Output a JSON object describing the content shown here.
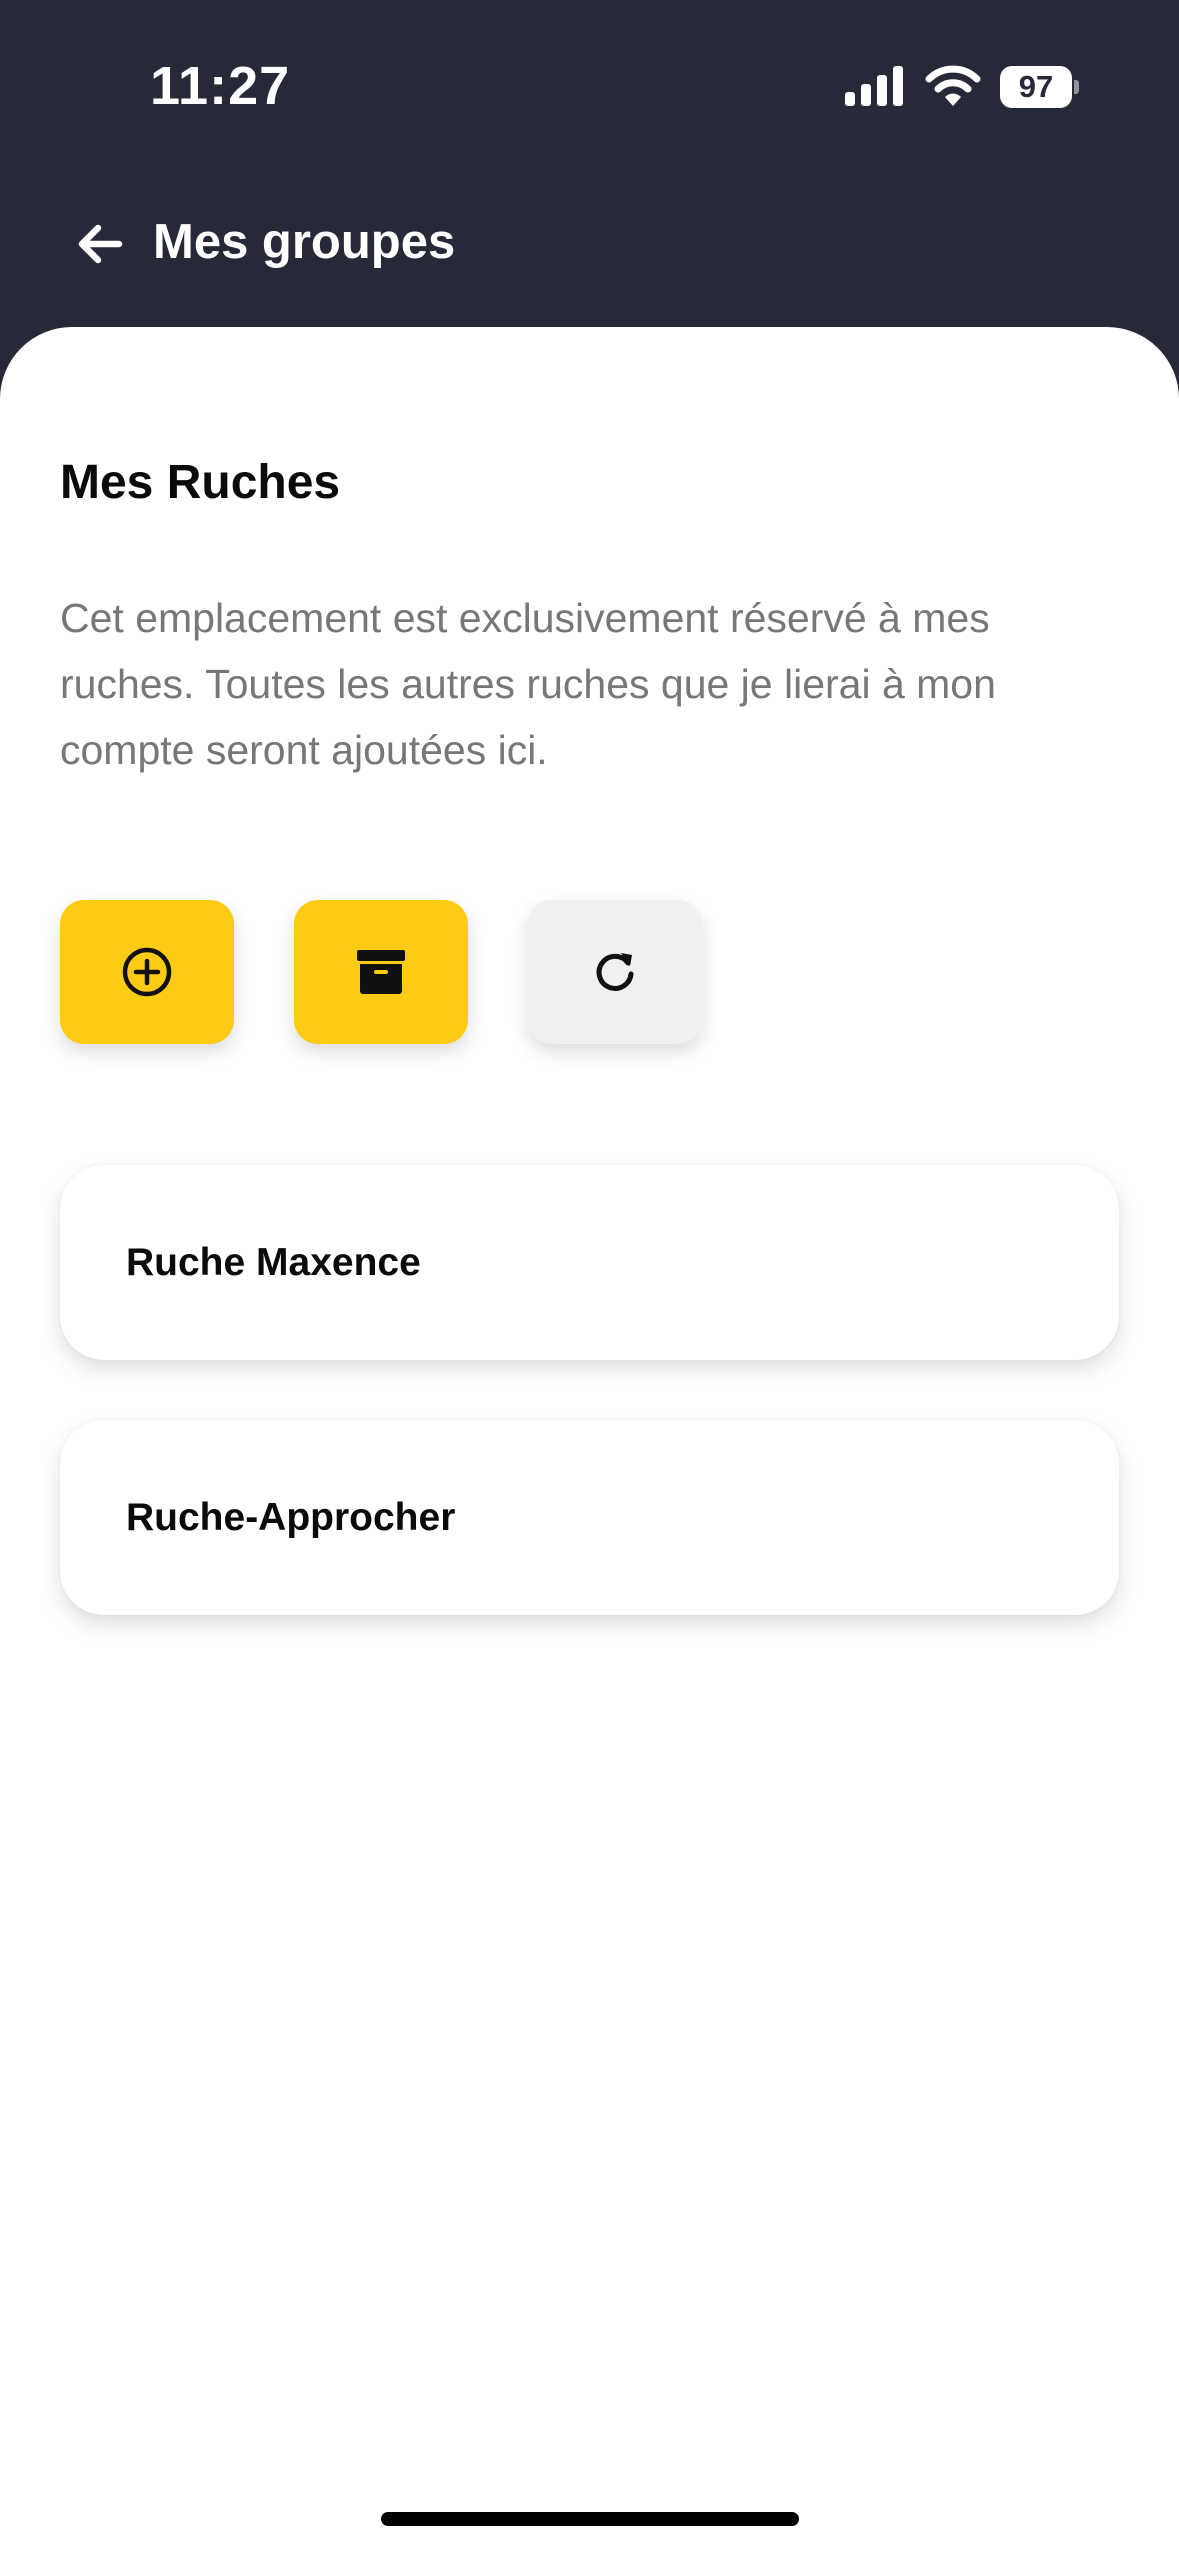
{
  "status_bar": {
    "time": "11:27",
    "battery_level": "97",
    "signal_icon": "cellular-signal-icon",
    "wifi_icon": "wifi-icon"
  },
  "header": {
    "back_icon": "arrow-left-icon",
    "title": "Mes groupes"
  },
  "main": {
    "title": "Mes Ruches",
    "description": "Cet emplacement est exclusivement réservé à mes ruches. Toutes les autres ruches que je lierai à mon compte seront ajoutées ici.",
    "actions": [
      {
        "icon": "add-circle-icon"
      },
      {
        "icon": "archive-box-icon"
      },
      {
        "icon": "refresh-icon"
      }
    ],
    "hives": [
      {
        "name": "Ruche Maxence"
      },
      {
        "name": "Ruche-Approcher"
      }
    ]
  },
  "colors": {
    "header_bg": "#252938",
    "accent_yellow": "#fdcb13",
    "neutral_button": "#f0f0f0",
    "description_text": "#777777"
  }
}
